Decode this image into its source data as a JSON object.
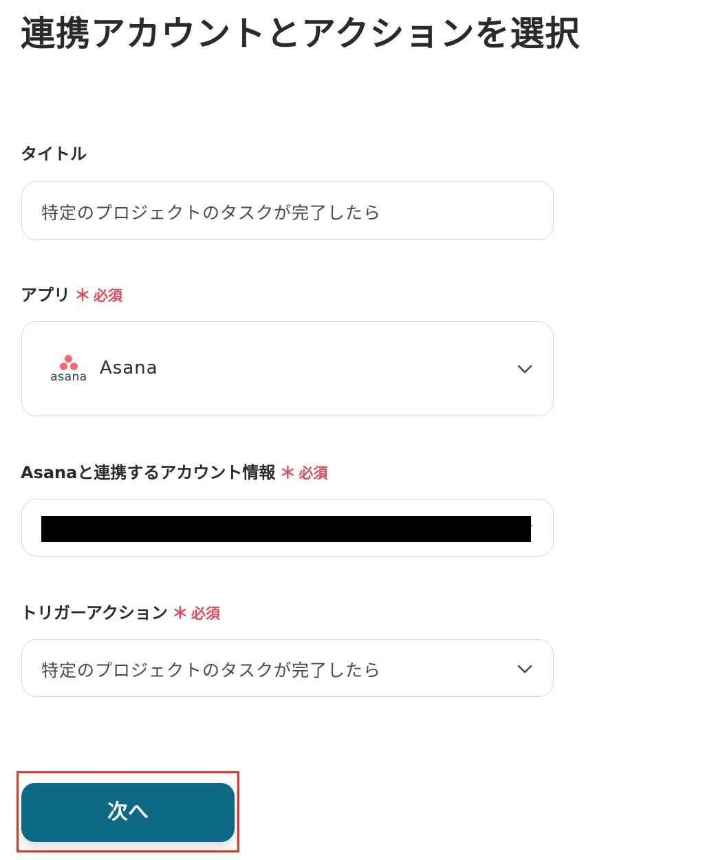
{
  "page_title": "連携アカウントとアクションを選択",
  "fields": {
    "title": {
      "label": "タイトル",
      "value": "特定のプロジェクトのタスクが完了したら"
    },
    "app": {
      "label": "アプリ",
      "required_mark": "＊",
      "required_text": "必須",
      "selected_value": "Asana",
      "logo_text": "asana",
      "logo_color": "#f06a6a"
    },
    "account": {
      "label": "Asanaと連携するアカウント情報",
      "required_mark": "＊",
      "required_text": "必須"
    },
    "trigger": {
      "label": "トリガーアクション",
      "required_mark": "＊",
      "required_text": "必須",
      "selected_value": "特定のプロジェクトのタスクが完了したら"
    }
  },
  "next_button": {
    "label": "次へ",
    "color": "#0e6985",
    "highlight_color": "#e8341c"
  },
  "colors": {
    "required": "#e8475a",
    "border": "#d6d9dd"
  }
}
